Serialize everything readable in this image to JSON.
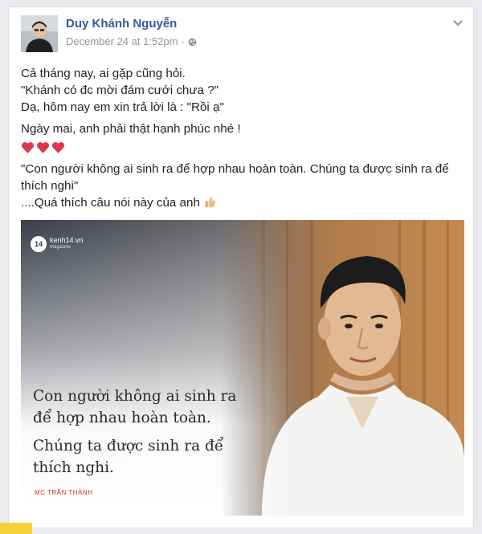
{
  "post": {
    "author": "Duy Khánh Nguyễn",
    "timestamp": "December 24 at 1:52pm",
    "separator": "·",
    "privacy_icon": "globe-icon",
    "menu_icon": "chevron-down-icon",
    "lines": [
      "Cả tháng nay, ai gặp cũng hỏi.",
      "\"Khánh có đc mời đám cưới chưa ?\"",
      "Dạ, hôm nay em xin trả lời là : \"Rồi ạ\"",
      "Ngày mai, anh phải thật hạnh phúc nhé !",
      "\"Con người không ai sinh ra để hợp nhau hoàn toàn. Chúng ta được sinh ra để thích nghi\"",
      "....Quá thích câu nói này của anh"
    ],
    "hearts": [
      "heart-emoji",
      "heart-emoji",
      "heart-emoji"
    ],
    "thumb_emoji": "thumbs-up-emoji"
  },
  "image": {
    "logo_badge": "14",
    "logo_name": "kenh14.vn",
    "logo_sub": "Magazine",
    "quote_lines": [
      "Con người không ai sinh ra",
      "để hợp nhau hoàn toàn.",
      "Chúng ta được sinh ra để",
      "thích nghi."
    ],
    "credit": "MC TRẤN THÀNH"
  },
  "colors": {
    "author": "#365899",
    "meta": "#90949c",
    "text": "#1d2129",
    "heart": "#e0354f",
    "credit": "#c0392b"
  }
}
